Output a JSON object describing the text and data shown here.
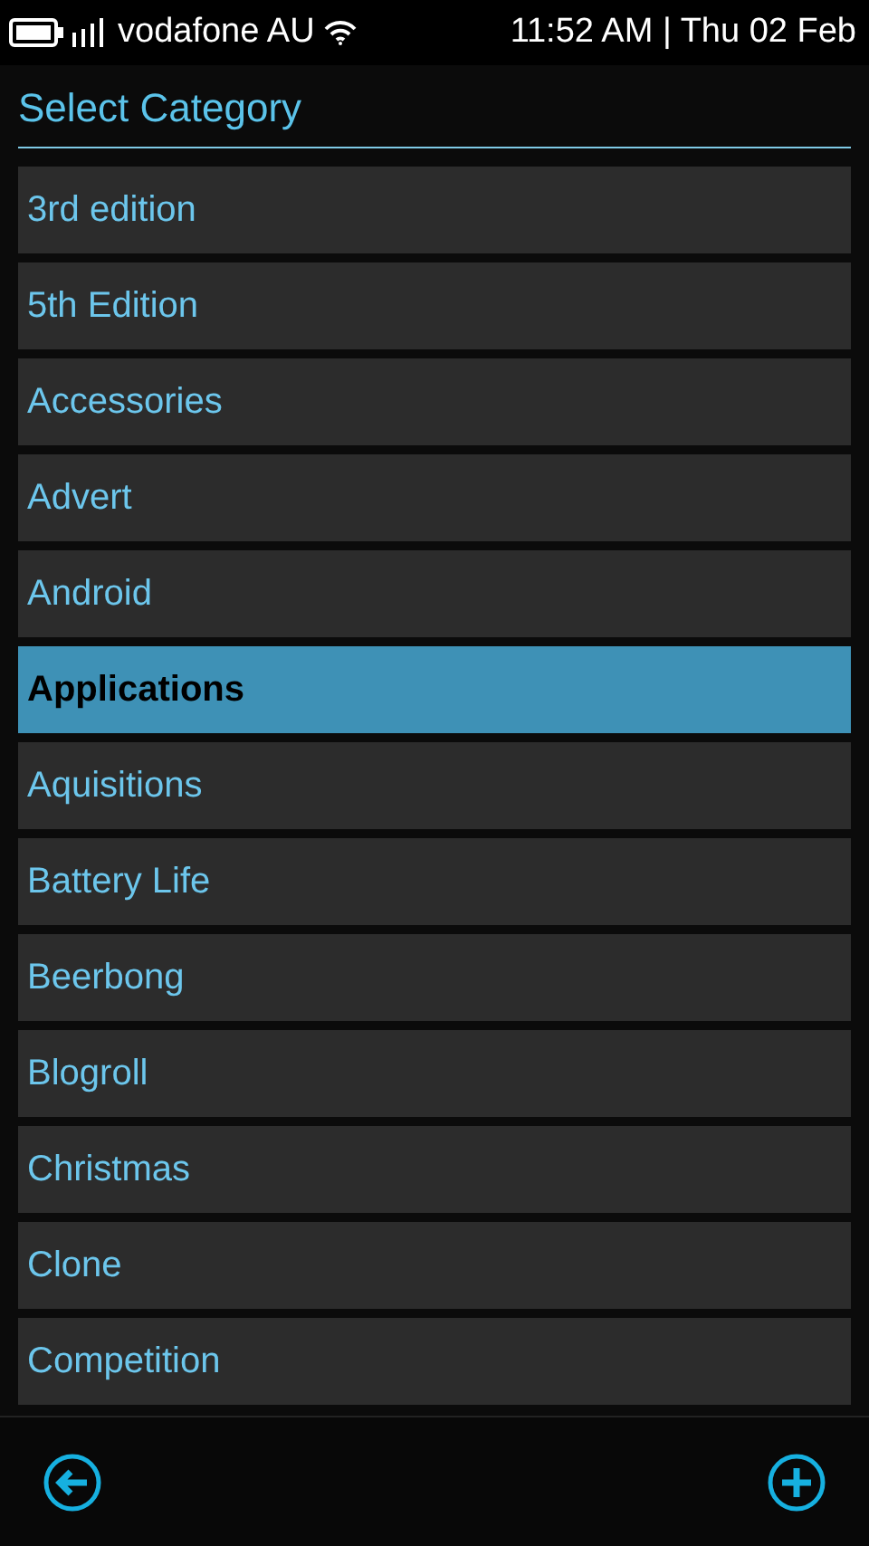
{
  "status_bar": {
    "carrier": "vodafone AU",
    "datetime": "11:52 AM | Thu 02 Feb"
  },
  "header": {
    "title": "Select Category"
  },
  "categories": [
    {
      "label": "3rd edition",
      "selected": false
    },
    {
      "label": "5th Edition",
      "selected": false
    },
    {
      "label": "Accessories",
      "selected": false
    },
    {
      "label": "Advert",
      "selected": false
    },
    {
      "label": "Android",
      "selected": false
    },
    {
      "label": "Applications",
      "selected": true
    },
    {
      "label": "Aquisitions",
      "selected": false
    },
    {
      "label": "Battery Life",
      "selected": false
    },
    {
      "label": "Beerbong",
      "selected": false
    },
    {
      "label": "Blogroll",
      "selected": false
    },
    {
      "label": "Christmas",
      "selected": false
    },
    {
      "label": "Clone",
      "selected": false
    },
    {
      "label": "Competition",
      "selected": false
    }
  ]
}
